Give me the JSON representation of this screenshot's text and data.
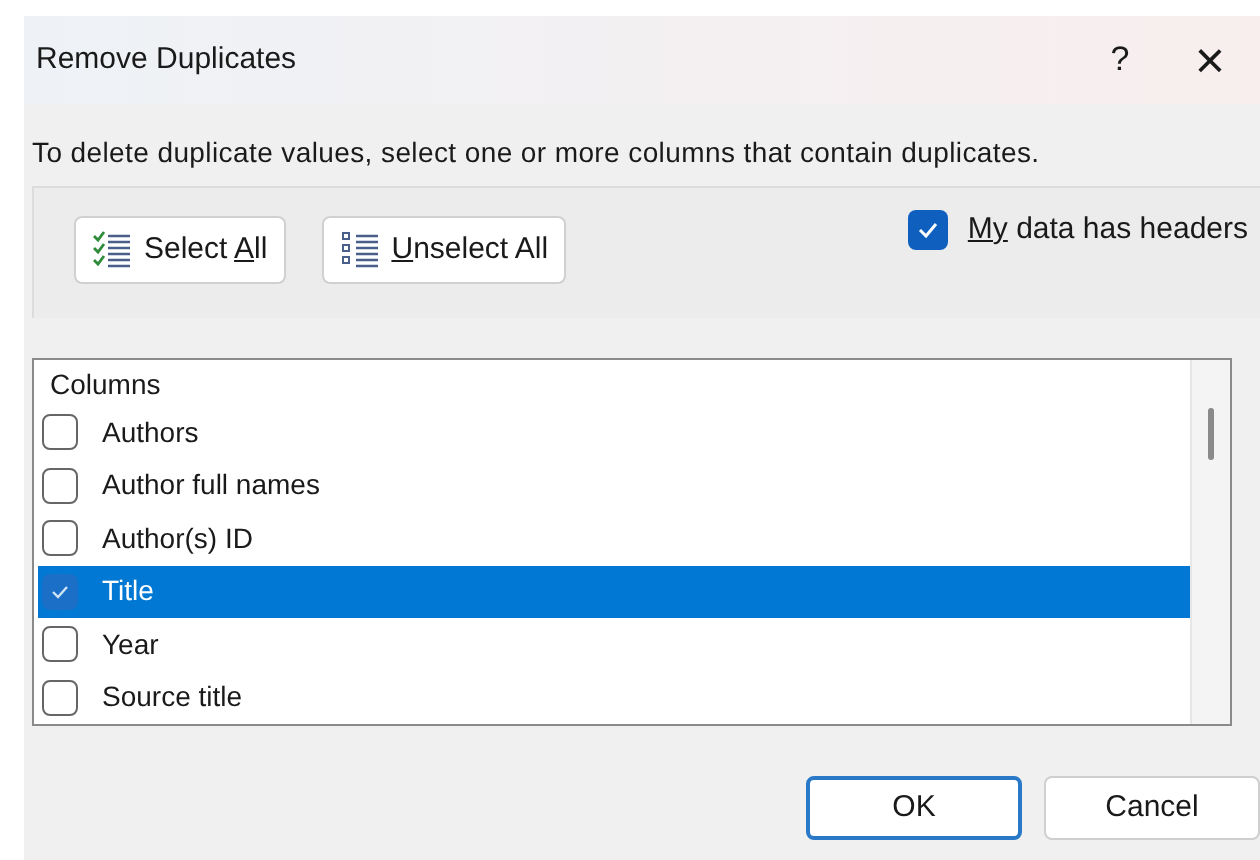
{
  "window": {
    "title": "Remove Duplicates",
    "help": "?",
    "close": "×"
  },
  "instruction": "To delete duplicate values, select one or more columns that contain duplicates.",
  "buttons": [
    {
      "kind": "select",
      "before": "Select ",
      "key": "A",
      "after": "ll"
    },
    {
      "kind": "unselect",
      "key": "U",
      "after": "nselect All"
    }
  ],
  "headers": {
    "key": "My",
    "after": " data has headers",
    "checked": true
  },
  "list": {
    "header": "Columns",
    "items": [
      {
        "label": "Authors",
        "checked": false,
        "selected": false
      },
      {
        "label": "Author full names",
        "checked": false,
        "selected": false
      },
      {
        "label": "Author(s) ID",
        "checked": false,
        "selected": false
      },
      {
        "label": "Title",
        "checked": true,
        "selected": true
      },
      {
        "label": "Year",
        "checked": false,
        "selected": false
      },
      {
        "label": "Source title",
        "checked": false,
        "selected": false
      }
    ]
  },
  "footer": [
    {
      "label": "OK",
      "default": true
    },
    {
      "label": "Cancel",
      "default": false
    }
  ]
}
